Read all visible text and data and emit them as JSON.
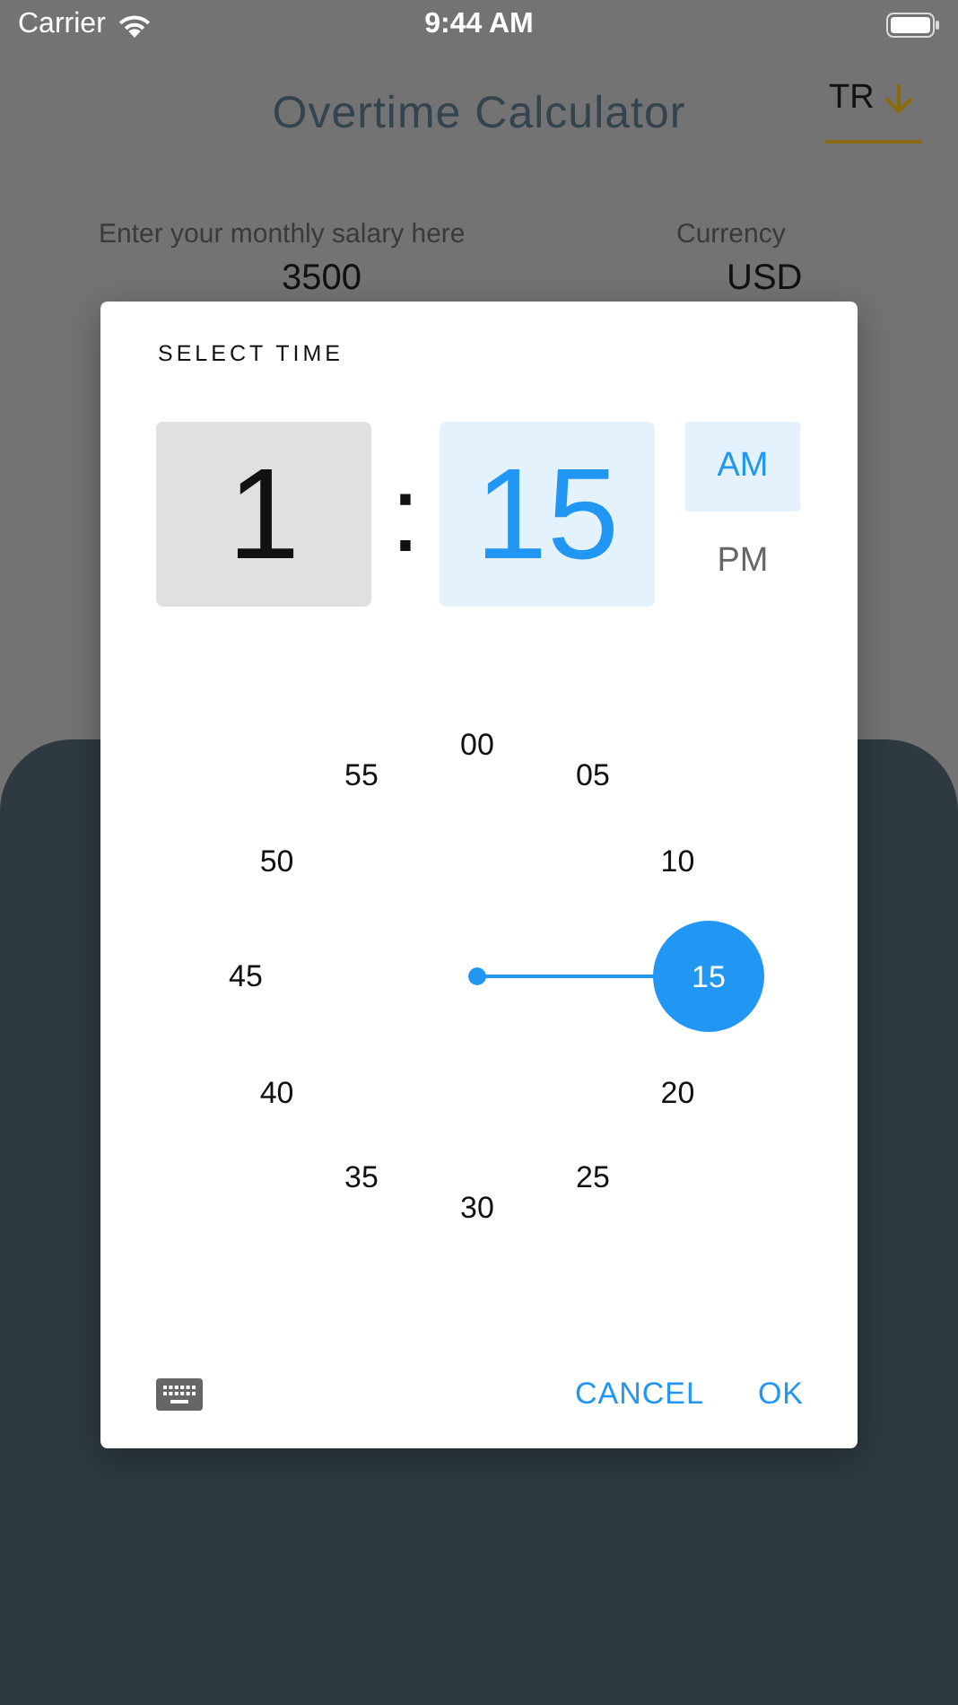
{
  "status_bar": {
    "carrier": "Carrier",
    "time": "9:44 AM"
  },
  "header": {
    "title": "Overtime Calculator",
    "language_button": "TR"
  },
  "salary": {
    "label": "Enter your monthly salary here",
    "value": "3500"
  },
  "currency": {
    "label": "Currency",
    "value": "USD"
  },
  "time_picker": {
    "title": "SELECT TIME",
    "hour": "1",
    "separator": ":",
    "minute": "15",
    "hour_selected": false,
    "minute_selected": true,
    "periods": [
      {
        "label": "AM",
        "selected": true
      },
      {
        "label": "PM",
        "selected": false
      }
    ],
    "dial": [
      {
        "label": "00",
        "selected": false
      },
      {
        "label": "05",
        "selected": false
      },
      {
        "label": "10",
        "selected": false
      },
      {
        "label": "15",
        "selected": true
      },
      {
        "label": "20",
        "selected": false
      },
      {
        "label": "25",
        "selected": false
      },
      {
        "label": "30",
        "selected": false
      },
      {
        "label": "35",
        "selected": false
      },
      {
        "label": "40",
        "selected": false
      },
      {
        "label": "45",
        "selected": false
      },
      {
        "label": "50",
        "selected": false
      },
      {
        "label": "55",
        "selected": false
      }
    ],
    "buttons": [
      "CANCEL",
      "OK"
    ]
  }
}
